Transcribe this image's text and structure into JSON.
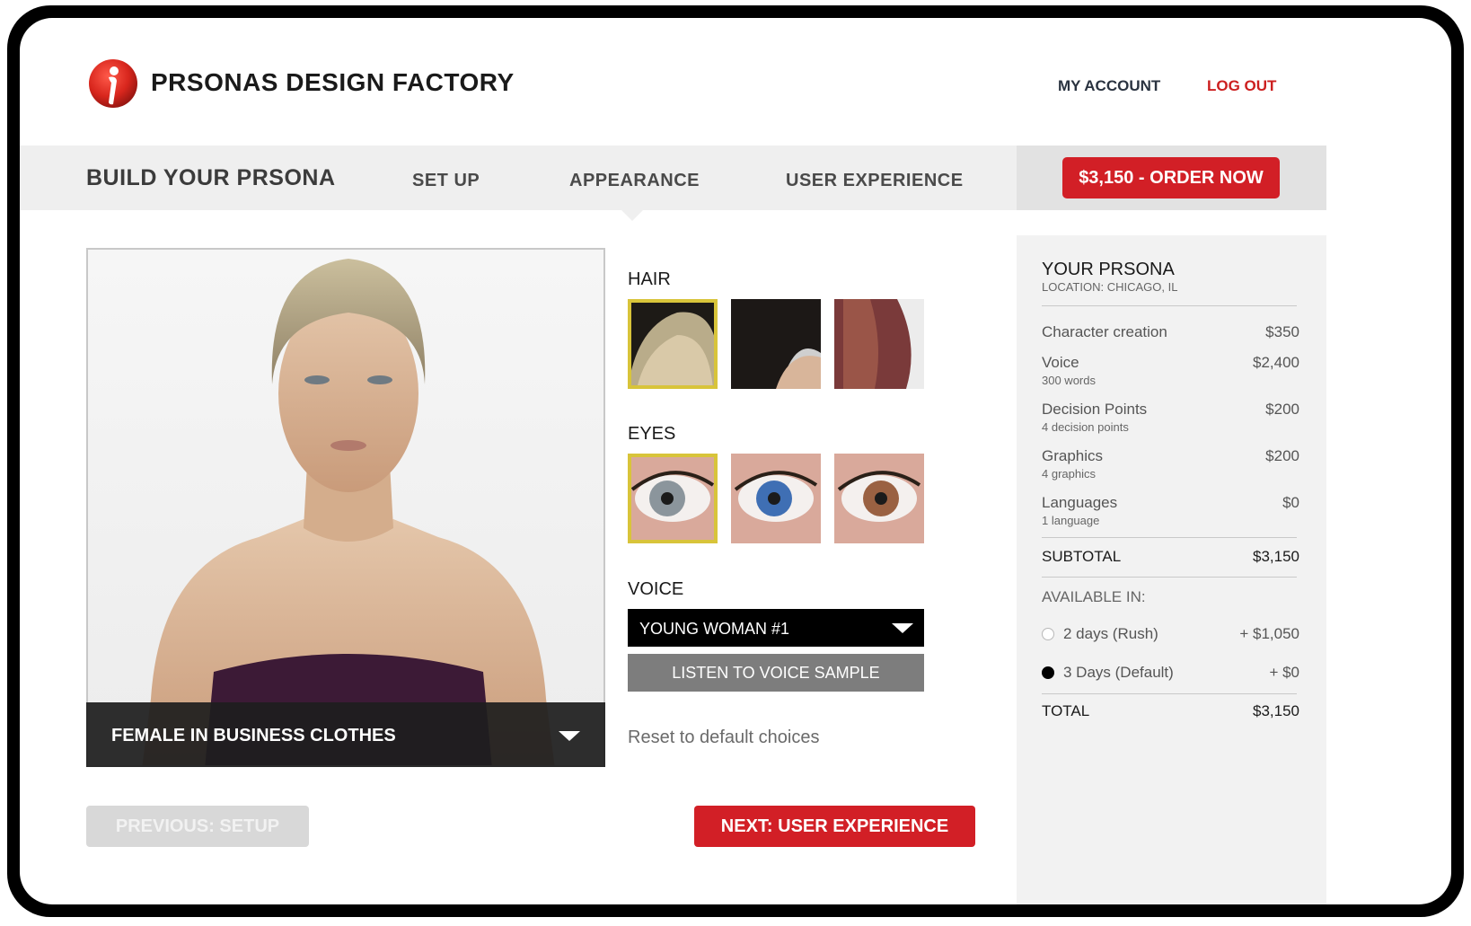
{
  "header": {
    "brand": "PRSONAS DESIGN FACTORY",
    "my_account": "MY ACCOUNT",
    "log_out": "LOG OUT"
  },
  "nav": {
    "title": "BUILD YOUR PRSONA",
    "tabs": [
      {
        "label": "SET UP"
      },
      {
        "label": "APPEARANCE",
        "active": true
      },
      {
        "label": "USER EXPERIENCE"
      }
    ],
    "order_button": "$3,150 - ORDER NOW"
  },
  "preview": {
    "outfit": "FEMALE IN BUSINESS CLOTHES"
  },
  "options": {
    "hair_label": "HAIR",
    "eyes_label": "EYES",
    "voice_label": "VOICE",
    "voice_value": "YOUNG WOMAN #1",
    "listen_button": "LISTEN TO VOICE SAMPLE",
    "reset_link": "Reset to default choices"
  },
  "footer": {
    "previous_button": "PREVIOUS: SETUP",
    "next_button": "NEXT: USER EXPERIENCE"
  },
  "summary": {
    "title": "YOUR PRSONA",
    "location": "LOCATION: CHICAGO, IL",
    "items": [
      {
        "name": "Character creation",
        "sub": "",
        "price": "$350"
      },
      {
        "name": "Voice",
        "sub": "300 words",
        "price": "$2,400"
      },
      {
        "name": "Decision Points",
        "sub": "4 decision points",
        "price": "$200"
      },
      {
        "name": "Graphics",
        "sub": "4 graphics",
        "price": "$200"
      },
      {
        "name": "Languages",
        "sub": "1 language",
        "price": "$0"
      }
    ],
    "subtotal_label": "SUBTOTAL",
    "subtotal_value": "$3,150",
    "available_label": "AVAILABLE IN:",
    "delivery": [
      {
        "label": "2 days (Rush)",
        "price": "+ $1,050",
        "checked": false
      },
      {
        "label": "3 Days (Default)",
        "price": "+ $0",
        "checked": true
      }
    ],
    "total_label": "TOTAL",
    "total_value": "$3,150"
  },
  "colors": {
    "accent_red": "#d21f26",
    "selected_outline": "#d8c43a"
  }
}
